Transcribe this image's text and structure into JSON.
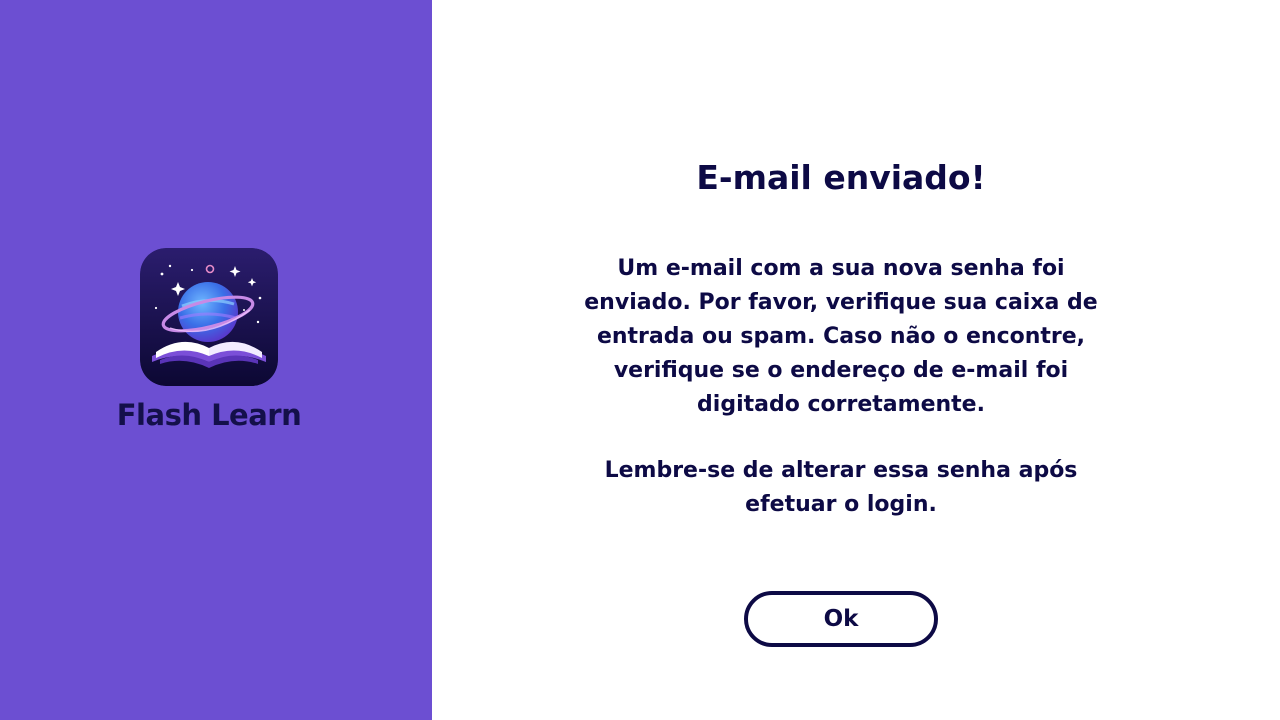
{
  "brand": {
    "name": "Flash Learn",
    "icon": "planet-over-open-book-logo",
    "panel_color": "#6c4fd2"
  },
  "dialog": {
    "title": "E-mail enviado!",
    "message": "Um e-mail com a sua nova senha foi enviado. Por favor, verifique sua caixa de entrada ou spam. Caso não o encontre, verifique se o endereço de e-mail foi digitado corretamente.",
    "reminder": "Lembre-se de alterar essa senha após efetuar o login.",
    "ok_label": "Ok",
    "text_color": "#0d0a45"
  }
}
